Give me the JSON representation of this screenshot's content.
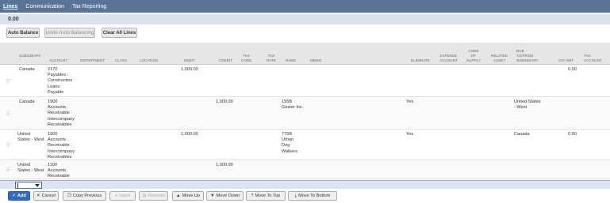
{
  "tabs": [
    {
      "label": "Lines",
      "active": true
    },
    {
      "label": "Communication",
      "active": false
    },
    {
      "label": "Tax Reporting",
      "active": false
    }
  ],
  "total": "0.00",
  "top_buttons": {
    "auto_balance": "Auto Balance",
    "undo_auto": "Undo Auto Balancing",
    "clear_all": "Clear All Lines"
  },
  "columns": {
    "subsidiary": "SUBSIDIARY",
    "account": "ACCOUNT",
    "department": "DEPARTMENT",
    "class": "CLASS",
    "location": "LOCATION",
    "debit": "DEBIT",
    "credit": "CREDIT",
    "tax_code": "TAX\nCODE",
    "tax_rate": "TAX\nRATE",
    "name": "NAME",
    "memo": "MEMO",
    "eliminate": "ELIMINATE",
    "expense_account": "EXPENSE\nACCOUNT",
    "code_of_supply": "CODE\nOF\nSUPPLY",
    "related_asset": "RELATED\nASSET",
    "due_to_from": "DUE\nTO/FROM\nSUBSIDIARY",
    "vat_amt": "VAT AMT",
    "tax_account": "TAX\nACCOUNT"
  },
  "rows": [
    {
      "subsidiary": "Canada",
      "account": "2170\nPayables :\nConstruction\nLoans\nPayable",
      "debit": "1,000.00",
      "credit": "",
      "name": "",
      "eliminate": "",
      "due": "",
      "vat": "0.00"
    },
    {
      "subsidiary": "Canada",
      "account": "1900\nAccounts\nReceivable :\nIntercompany\nReceivables",
      "debit": "",
      "credit": "1,000.00",
      "name": "195B\nGester Inc.",
      "eliminate": "Yes",
      "due": "United States\n- West",
      "vat": ""
    },
    {
      "subsidiary": "United\nStates - West",
      "account": "1900\nAccounts\nReceivable :\nIntercompany\nReceivables",
      "debit": "1,000.00",
      "credit": "",
      "name": "775B\nUrban\nDog\nWalkers",
      "eliminate": "Yes",
      "due": "Canada",
      "vat": "0.00"
    },
    {
      "subsidiary": "United\nStates - West",
      "account": "1100\nAccounts\nReceivable",
      "debit": "",
      "credit": "1,000.00",
      "name": "",
      "eliminate": "",
      "due": "",
      "vat": ""
    }
  ],
  "actions": {
    "add": "Add",
    "cancel": "Cancel",
    "copy_previous": "Copy Previous",
    "insert": "Insert",
    "remove": "Remove",
    "move_up": "Move Up",
    "move_down": "Move Down",
    "move_to_top": "Move To Top",
    "move_to_bottom": "Move To Bottom"
  }
}
